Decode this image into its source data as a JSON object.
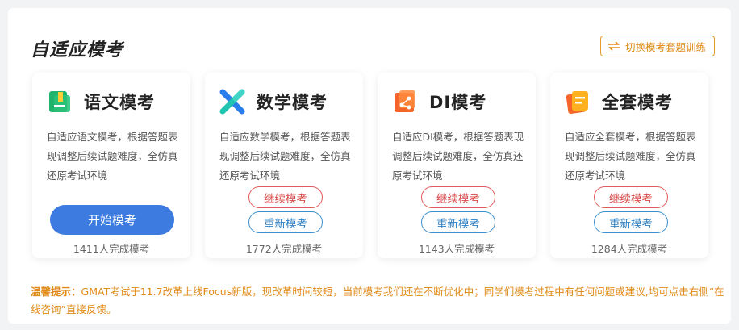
{
  "page": {
    "title": "自适应模考",
    "switch_button": "切换模考套题训练"
  },
  "cards": [
    {
      "title": "语文模考",
      "description": "自适应语文模考，根据答题表现调整后续试题难度，全仿真还原考试环境",
      "start_label": "开始模考",
      "completed": "1411人完成模考"
    },
    {
      "title": "数学模考",
      "description": "自适应数学模考，根据答题表现调整后续试题难度，全仿真还原考试环境",
      "continue_label": "继续模考",
      "restart_label": "重新模考",
      "completed": "1772人完成模考"
    },
    {
      "title": "DI模考",
      "description": "自适应DI模考，根据答题表现调整后续试题难度，全仿真还原考试环境",
      "continue_label": "继续模考",
      "restart_label": "重新模考",
      "completed": "1143人完成模考"
    },
    {
      "title": "全套模考",
      "description": "自适应全套模考，根据答题表现调整后续试题难度，全仿真还原考试环境",
      "continue_label": "继续模考",
      "restart_label": "重新模考",
      "completed": "1284人完成模考"
    }
  ],
  "notice": {
    "label": "温馨提示：",
    "text": "GMAT考试于11.7改革上线Focus新版，现改革时间较短，当前模考我们还在不断优化中；同学们模考过程中有任何问题或建议,均可点击右侧“在线咨询”直接反馈。"
  },
  "colors": {
    "accent_blue": "#3d7be0",
    "continue_red": "#d94848",
    "restart_blue": "#2f7fc2",
    "warning_orange": "#e08a17"
  },
  "icons": {
    "switch": "swap-arrows-icon",
    "verbal": "verbal-exam-icon",
    "math": "math-exam-icon",
    "di": "di-exam-icon",
    "full": "full-exam-icon"
  }
}
